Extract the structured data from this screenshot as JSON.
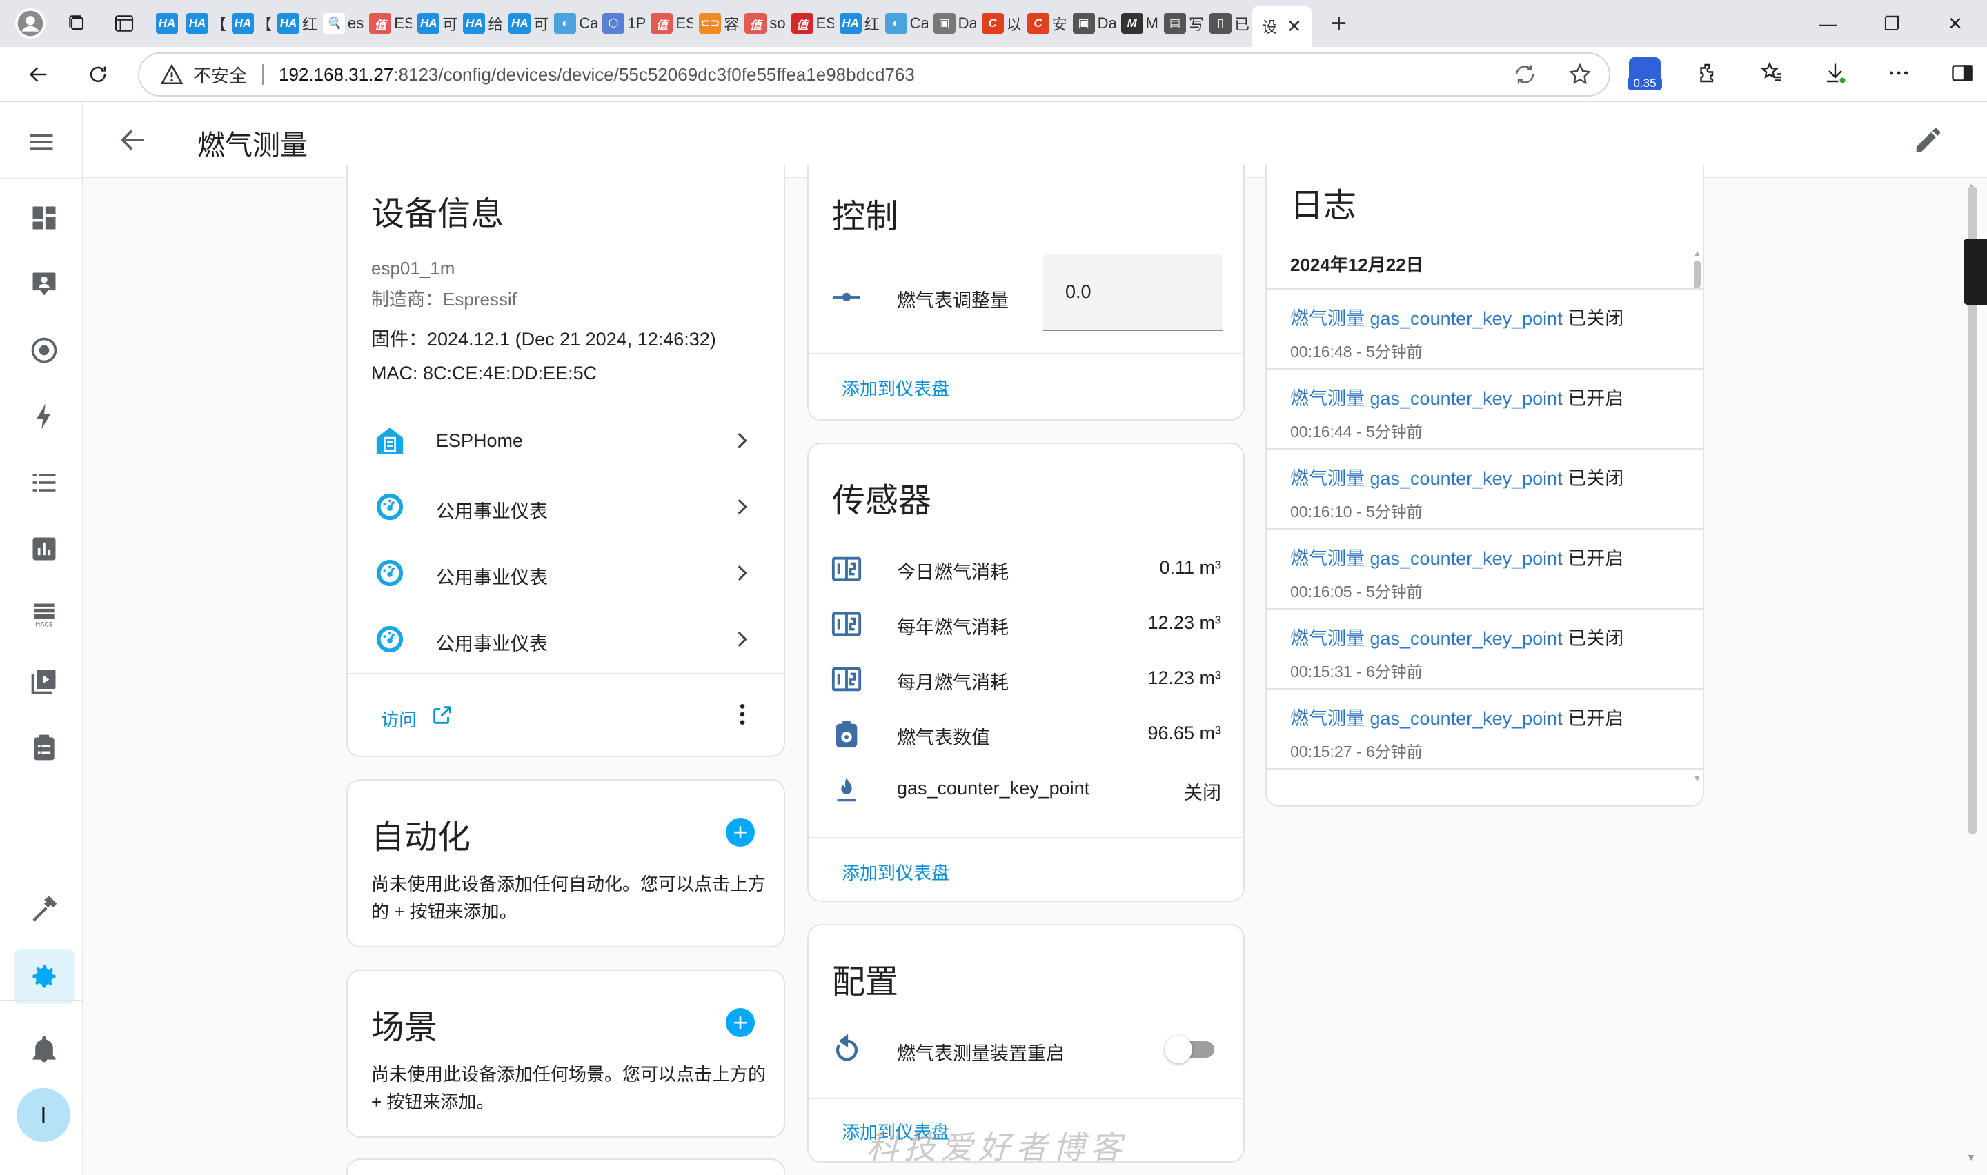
{
  "browser": {
    "tabs": [
      {
        "fav": "HA",
        "color": "#1f8fe0",
        "title": ""
      },
      {
        "fav": "HA",
        "color": "#1f8fe0",
        "title": "【"
      },
      {
        "fav": "HA",
        "color": "#1f8fe0",
        "title": "【"
      },
      {
        "fav": "HA",
        "color": "#1f8fe0",
        "title": "红"
      },
      {
        "fav": "🔍",
        "color": "#ffffff",
        "title": "es"
      },
      {
        "fav": "值",
        "color": "#e25a54",
        "title": "ES"
      },
      {
        "fav": "HA",
        "color": "#1f8fe0",
        "title": "可"
      },
      {
        "fav": "HA",
        "color": "#1f8fe0",
        "title": "给"
      },
      {
        "fav": "HA",
        "color": "#1f8fe0",
        "title": "可"
      },
      {
        "fav": "◐",
        "color": "#4aa3df",
        "title": "Ca"
      },
      {
        "fav": "⬡",
        "color": "#5b7fd4",
        "title": "1P"
      },
      {
        "fav": "值",
        "color": "#e25a54",
        "title": "ES"
      },
      {
        "fav": "⊂⊃",
        "color": "#f08a24",
        "title": "容"
      },
      {
        "fav": "值",
        "color": "#e25a54",
        "title": "so"
      },
      {
        "fav": "值",
        "color": "#d62828",
        "title": "ES"
      },
      {
        "fav": "HA",
        "color": "#1f8fe0",
        "title": "红"
      },
      {
        "fav": "◐",
        "color": "#4aa3df",
        "title": "Ca"
      },
      {
        "fav": "▣",
        "color": "#777777",
        "title": "Da"
      },
      {
        "fav": "C",
        "color": "#e2401c",
        "title": "以"
      },
      {
        "fav": "C",
        "color": "#e2401c",
        "title": "安"
      },
      {
        "fav": "▣",
        "color": "#555555",
        "title": "Da"
      },
      {
        "fav": "M",
        "color": "#333333",
        "title": "M"
      },
      {
        "fav": "▤",
        "color": "#555555",
        "title": "写"
      },
      {
        "fav": "▯",
        "color": "#555555",
        "title": "已"
      }
    ],
    "active_tab_title": "设",
    "insecure_label": "不安全",
    "url_host": "192.168.31.27",
    "url_rest": ":8123/config/devices/device/55c52069dc3f0fe55ffea1e98bdcd763",
    "extension_badge": "0.35"
  },
  "app": {
    "title": "燃气测量"
  },
  "device_info": {
    "title": "设备信息",
    "model": "esp01_1m",
    "manufacturer": "制造商：Espressif",
    "firmware": "固件：2024.12.1 (Dec 21 2024, 12:46:32)",
    "mac": "MAC: 8C:CE:4E:DD:EE:5C",
    "integrations": [
      "ESPHome",
      "公用事业仪表",
      "公用事业仪表",
      "公用事业仪表"
    ],
    "visit_label": "访问"
  },
  "automation": {
    "title": "自动化",
    "text": "尚未使用此设备添加任何自动化。您可以点击上方的 + 按钮来添加。"
  },
  "scene": {
    "title": "场景",
    "text": "尚未使用此设备添加任何场景。您可以点击上方的 + 按钮来添加。"
  },
  "controls": {
    "title": "控制",
    "number_label": "燃气表调整量",
    "number_value": "0.0",
    "add_label": "添加到仪表盘"
  },
  "sensors": {
    "title": "传感器",
    "items": [
      {
        "icon": "counter-icon",
        "label": "今日燃气消耗",
        "value": "0.11 m³"
      },
      {
        "icon": "counter-icon",
        "label": "每年燃气消耗",
        "value": "12.23 m³"
      },
      {
        "icon": "counter-icon",
        "label": "每月燃气消耗",
        "value": "12.23 m³"
      },
      {
        "icon": "meter-icon",
        "label": "燃气表数值",
        "value": "96.65 m³"
      },
      {
        "icon": "fire-icon",
        "label": "gas_counter_key_point",
        "value": "关闭"
      }
    ],
    "add_label": "添加到仪表盘"
  },
  "config": {
    "title": "配置",
    "restart_label": "燃气表测量装置重启",
    "add_label": "添加到仪表盘"
  },
  "logbook": {
    "title": "日志",
    "date": "2024年12月22日",
    "entries": [
      {
        "name": "燃气测量 gas_counter_key_point",
        "state": "已关闭",
        "time": "00:16:48 - 5分钟前"
      },
      {
        "name": "燃气测量 gas_counter_key_point",
        "state": "已开启",
        "time": "00:16:44 - 5分钟前"
      },
      {
        "name": "燃气测量 gas_counter_key_point",
        "state": "已关闭",
        "time": "00:16:10 - 5分钟前"
      },
      {
        "name": "燃气测量 gas_counter_key_point",
        "state": "已开启",
        "time": "00:16:05 - 5分钟前"
      },
      {
        "name": "燃气测量 gas_counter_key_point",
        "state": "已关闭",
        "time": "00:15:31 - 6分钟前"
      },
      {
        "name": "燃气测量 gas_counter_key_point",
        "state": "已开启",
        "time": "00:15:27 - 6分钟前"
      }
    ]
  },
  "watermark": "科技爱好者博客",
  "colors": {
    "accent": "#03a9f4",
    "link": "#0b8fd6",
    "entity_link": "#2f78c4",
    "sidebar_icon": "#5f6368"
  }
}
